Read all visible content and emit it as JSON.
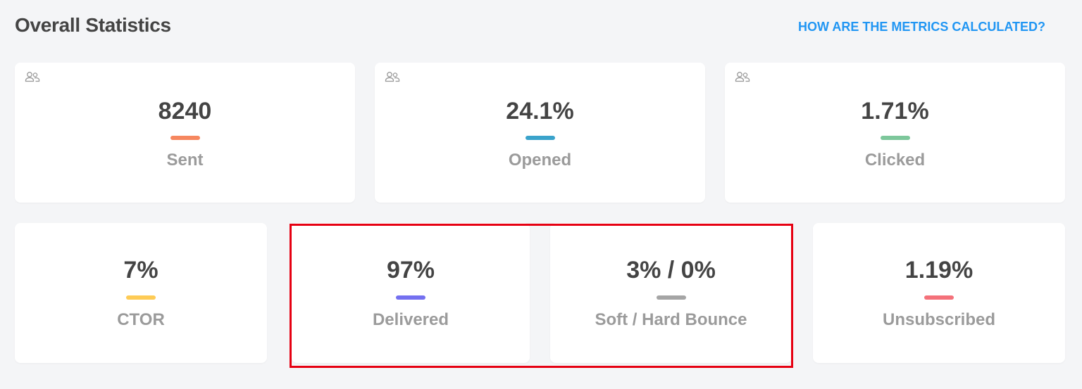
{
  "header": {
    "title": "Overall Statistics",
    "help_link": "HOW ARE THE METRICS CALCULATED?"
  },
  "stats_row1": [
    {
      "value": "8240",
      "label": "Sent",
      "color": "#f6875f",
      "icon": "users-icon"
    },
    {
      "value": "24.1%",
      "label": "Opened",
      "color": "#3aa3cb",
      "icon": "users-icon"
    },
    {
      "value": "1.71%",
      "label": "Clicked",
      "color": "#7dc79b",
      "icon": "users-icon"
    }
  ],
  "stats_row2": [
    {
      "value": "7%",
      "label": "CTOR",
      "color": "#fecb55"
    },
    {
      "value": "97%",
      "label": "Delivered",
      "color": "#7470f0"
    },
    {
      "value": "3% / 0%",
      "label": "Soft / Hard Bounce",
      "color": "#a5a5a5"
    },
    {
      "value": "1.19%",
      "label": "Unsubscribed",
      "color": "#f4717a"
    }
  ],
  "annotation": {
    "highlight_color": "#e60012"
  }
}
